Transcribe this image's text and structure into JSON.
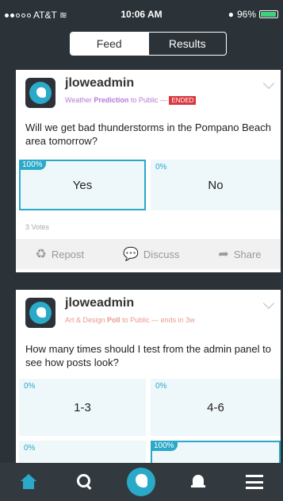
{
  "status_bar": {
    "carrier": "AT&T",
    "time": "10:06 AM",
    "battery": "96%"
  },
  "segmented": {
    "feed": "Feed",
    "results": "Results"
  },
  "posts": [
    {
      "username": "jloweadmin",
      "category": "Weather",
      "kind": "Prediction",
      "audience": "to Public —",
      "status": "ENDED",
      "question": "Will we get bad thunderstorms in the Pompano Beach area tomorrow?",
      "options": [
        {
          "label": "Yes",
          "percent": "100%"
        },
        {
          "label": "No",
          "percent": "0%"
        }
      ],
      "votes": "3 Votes",
      "actions": {
        "repost": "Repost",
        "discuss": "Discuss",
        "share": "Share"
      }
    },
    {
      "username": "jloweadmin",
      "category": "Art & Design",
      "kind": "Poll",
      "audience": "to Public —",
      "status": "ends in 3w",
      "question": "How many times should I test from the admin panel to see how posts look?",
      "options": [
        {
          "label": "1-3",
          "percent": "0%"
        },
        {
          "label": "4-6",
          "percent": "0%"
        },
        {
          "label": "",
          "percent": "0%"
        },
        {
          "label": "",
          "percent": "100%"
        }
      ]
    }
  ],
  "colors": {
    "accent": "#2aa9c9",
    "ended": "#d9363e",
    "background": "#2b3338"
  },
  "tabbar": [
    "home-icon",
    "search-icon",
    "center-logo-icon",
    "bell-icon",
    "menu-icon"
  ]
}
